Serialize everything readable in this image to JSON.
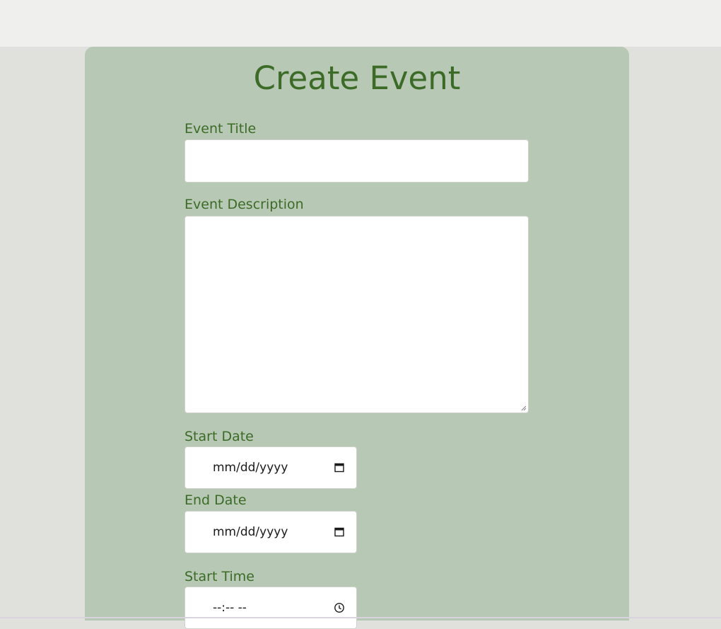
{
  "page": {
    "title": "Create Event"
  },
  "form": {
    "event_title": {
      "label": "Event Title",
      "value": ""
    },
    "event_description": {
      "label": "Event Description",
      "value": ""
    },
    "start_date": {
      "label": "Start Date",
      "placeholder": "mm/dd/yyyy"
    },
    "end_date": {
      "label": "End Date",
      "placeholder": "mm/dd/yyyy"
    },
    "start_time": {
      "label": "Start Time",
      "placeholder": "--:-- --"
    }
  },
  "icons": {
    "date": "calendar-icon",
    "time": "clock-icon"
  },
  "colors": {
    "card_background": "#b7c9b4",
    "accent_text": "#3c6b28",
    "page_background": "#e0e1dc"
  }
}
